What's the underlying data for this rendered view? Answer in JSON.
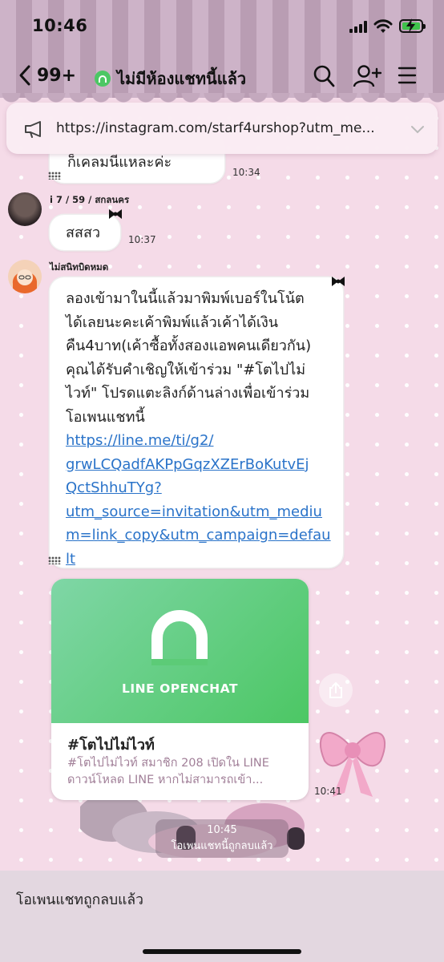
{
  "status_bar": {
    "time": "10:46"
  },
  "nav": {
    "back_count": "99+",
    "title": "ไม่มีห้องแชทนี้แล้ว"
  },
  "announcement": {
    "url": "https://instagram.com/starf4urshop?utm_me..."
  },
  "messages": [
    {
      "text": "ก็เคลมนีแหละค่ะ",
      "time": "10:34"
    },
    {
      "sender": "i 7 / 59 / สกลนคร",
      "text": "สสสว",
      "time": "10:37"
    },
    {
      "sender": "ไม่สนิทบิดหมด",
      "lines": [
        "ลองเข้ามาในนี้แล้วมาพิมพ์เบอร์ในโน้ต",
        "ได้เลยนะคะเค้าพิมพ์แล้วเค้าได้เงิน",
        "คืน4บาท(เค้าซื้อทั้งสองแอพคนเดียวกัน)",
        "คุณได้รับคำเชิญให้เข้าร่วม \"#โตไปไม่",
        "ไวท์\" โปรดแตะลิงก์ด้านล่างเพื่อเข้าร่วม",
        "โอเพนแชทนี้"
      ],
      "link_lines": [
        "https://line.me/ti/g2/",
        "grwLCQadfAKPpGqzXZErBoKutvEj",
        "QctShhuTYg?",
        "utm_source=invitation&utm_mediu",
        "m=link_copy&utm_campaign=defau",
        "lt"
      ]
    }
  ],
  "card": {
    "brand": "LINE OPENCHAT",
    "title": "#โตไปไม่ไวท์",
    "desc_line1": "#โตไปไม่ไวท์ สมาชิก 208 เปิดใน LINE",
    "desc_line2": "ดาวน์โหลด LINE หากไม่สามารถเข้า...",
    "time": "10:41"
  },
  "system_message": {
    "time": "10:45",
    "text": "โอเพนแชทนี้ถูกลบแล้ว"
  },
  "bottom": {
    "text": "โอเพนแชทถูกลบแล้ว"
  },
  "colors": {
    "openchat_green": "#4cc764",
    "link_blue": "#2a73c9",
    "wallpaper_pink": "#f5dbe8"
  }
}
